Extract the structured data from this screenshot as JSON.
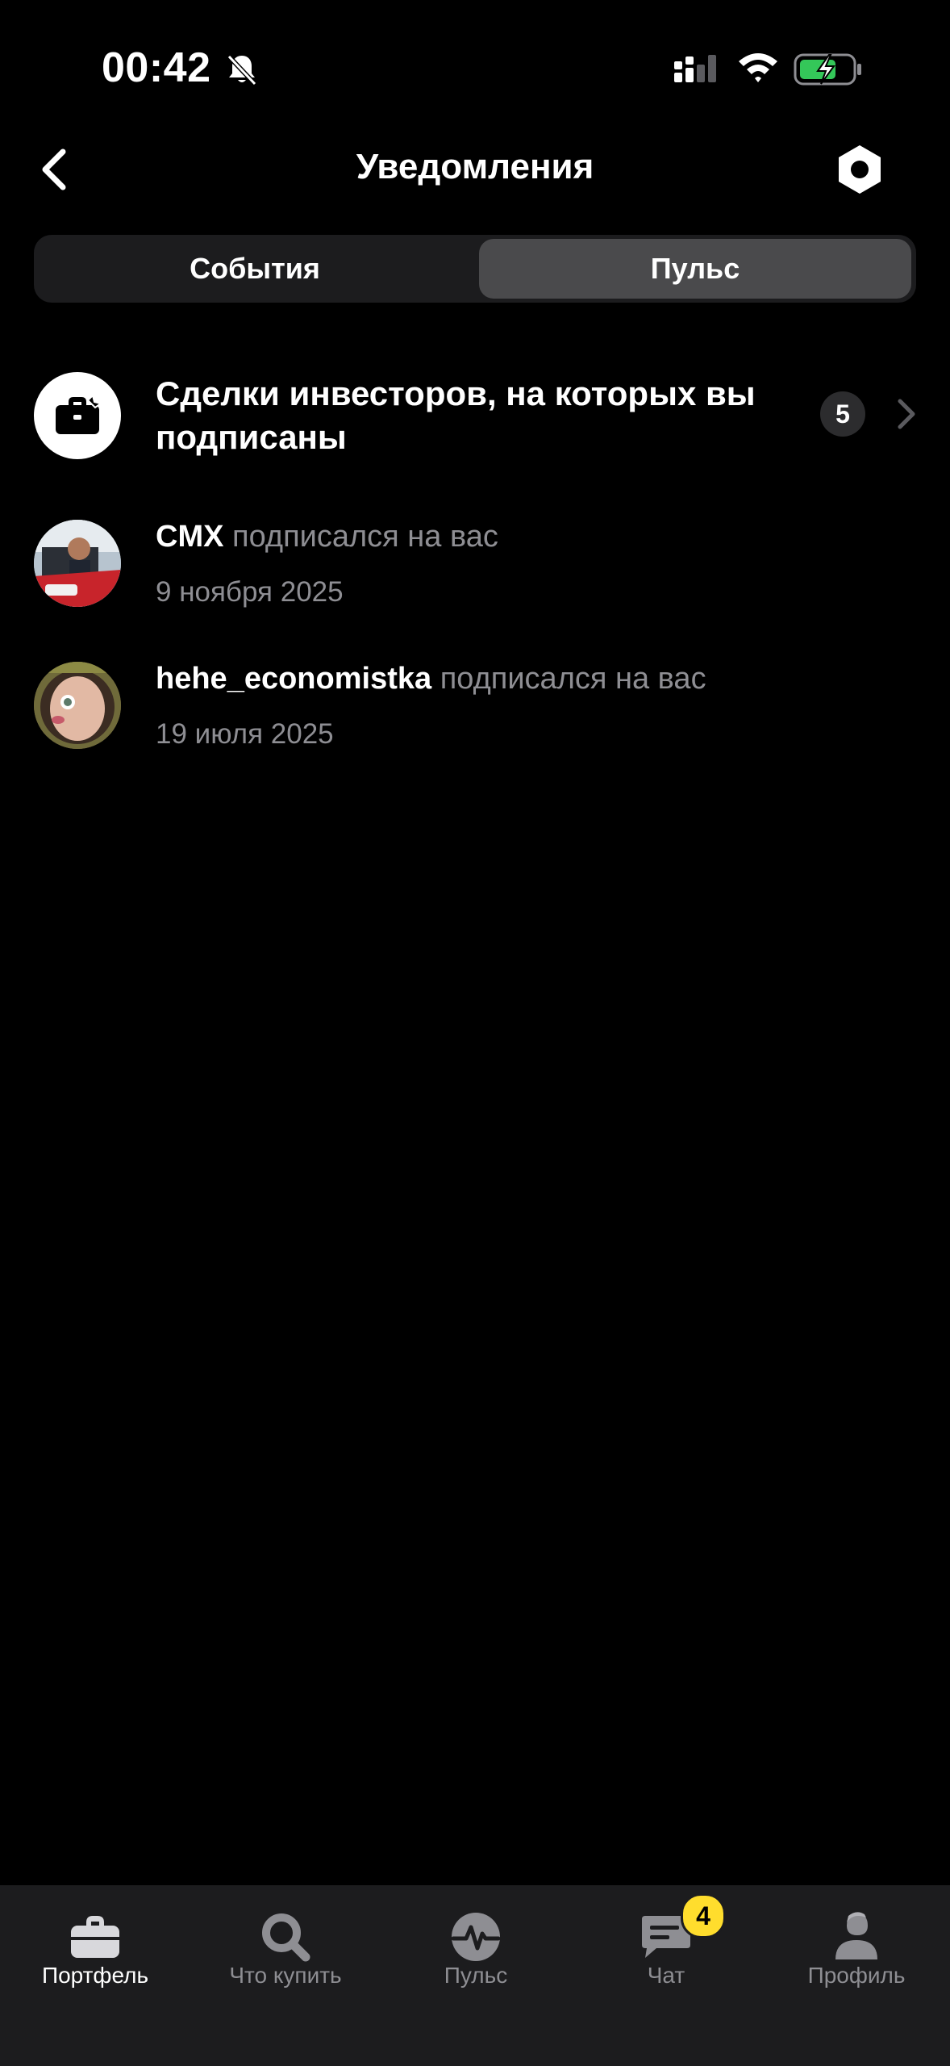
{
  "status_bar": {
    "time": "00:42",
    "icons": [
      "bell-off-icon",
      "signal-icon",
      "wifi-icon",
      "battery-charging-icon"
    ]
  },
  "header": {
    "title": "Уведомления",
    "back_icon": "chevron-left-icon",
    "settings_icon": "hexagon-gear-icon"
  },
  "tabs": [
    {
      "label": "События",
      "selected": false
    },
    {
      "label": "Пульс",
      "selected": true
    }
  ],
  "deals": {
    "title": "Сделки инвесторов, на которых вы подписаны",
    "count": "5",
    "icon": "briefcase-icon"
  },
  "notifications": [
    {
      "user": "CMX",
      "action": "подписался на вас",
      "date": "9 ноября 2025"
    },
    {
      "user": "hehe_economistka",
      "action": "подписался на вас",
      "date": "19 июля 2025"
    }
  ],
  "tab_bar": [
    {
      "label": "Портфель",
      "icon": "briefcase-icon",
      "active": true
    },
    {
      "label": "Что купить",
      "icon": "search-icon",
      "active": false
    },
    {
      "label": "Пульс",
      "icon": "pulse-icon",
      "active": false
    },
    {
      "label": "Чат",
      "icon": "chat-icon",
      "active": false,
      "badge": "4"
    },
    {
      "label": "Профиль",
      "icon": "profile-icon",
      "active": false
    }
  ],
  "colors": {
    "background": "#000000",
    "surface": "#1c1c1e",
    "selected_tab": "#4a4a4c",
    "secondary_text": "#8e8e93",
    "badge_yellow": "#ffdd2d",
    "battery_green": "#34c759"
  }
}
